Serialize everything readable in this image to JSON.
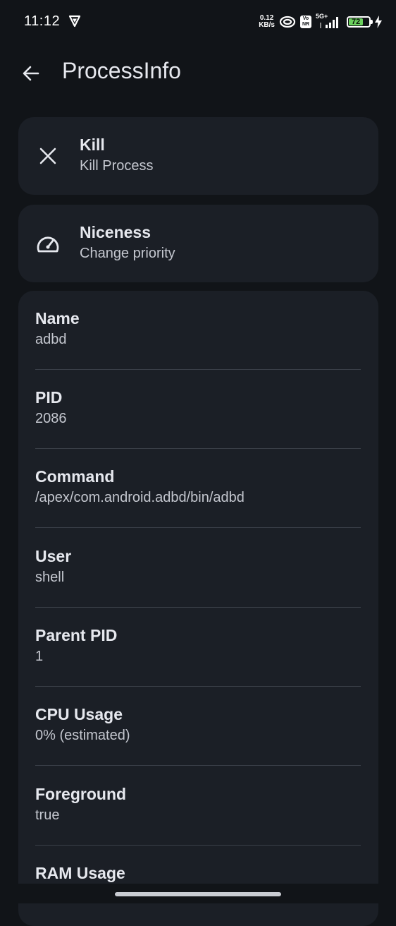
{
  "status_bar": {
    "time": "11:12",
    "net_speed_value": "0.12",
    "net_speed_unit": "KB/s",
    "volte_label": "Vo NR",
    "network_type": "5G+",
    "battery_level": "72",
    "battery_color": "#6cd15e"
  },
  "app_bar": {
    "title": "ProcessInfo"
  },
  "actions": [
    {
      "title": "Kill",
      "subtitle": "Kill Process",
      "icon": "close-icon"
    },
    {
      "title": "Niceness",
      "subtitle": "Change priority",
      "icon": "speedometer-icon"
    }
  ],
  "info": [
    {
      "label": "Name",
      "value": "adbd"
    },
    {
      "label": "PID",
      "value": "2086"
    },
    {
      "label": "Command",
      "value": "/apex/com.android.adbd/bin/adbd"
    },
    {
      "label": "User",
      "value": "shell"
    },
    {
      "label": "Parent PID",
      "value": "1"
    },
    {
      "label": "CPU Usage",
      "value": "0% (estimated)"
    },
    {
      "label": "Foreground",
      "value": "true"
    },
    {
      "label": "RAM Usage",
      "value": ""
    }
  ]
}
